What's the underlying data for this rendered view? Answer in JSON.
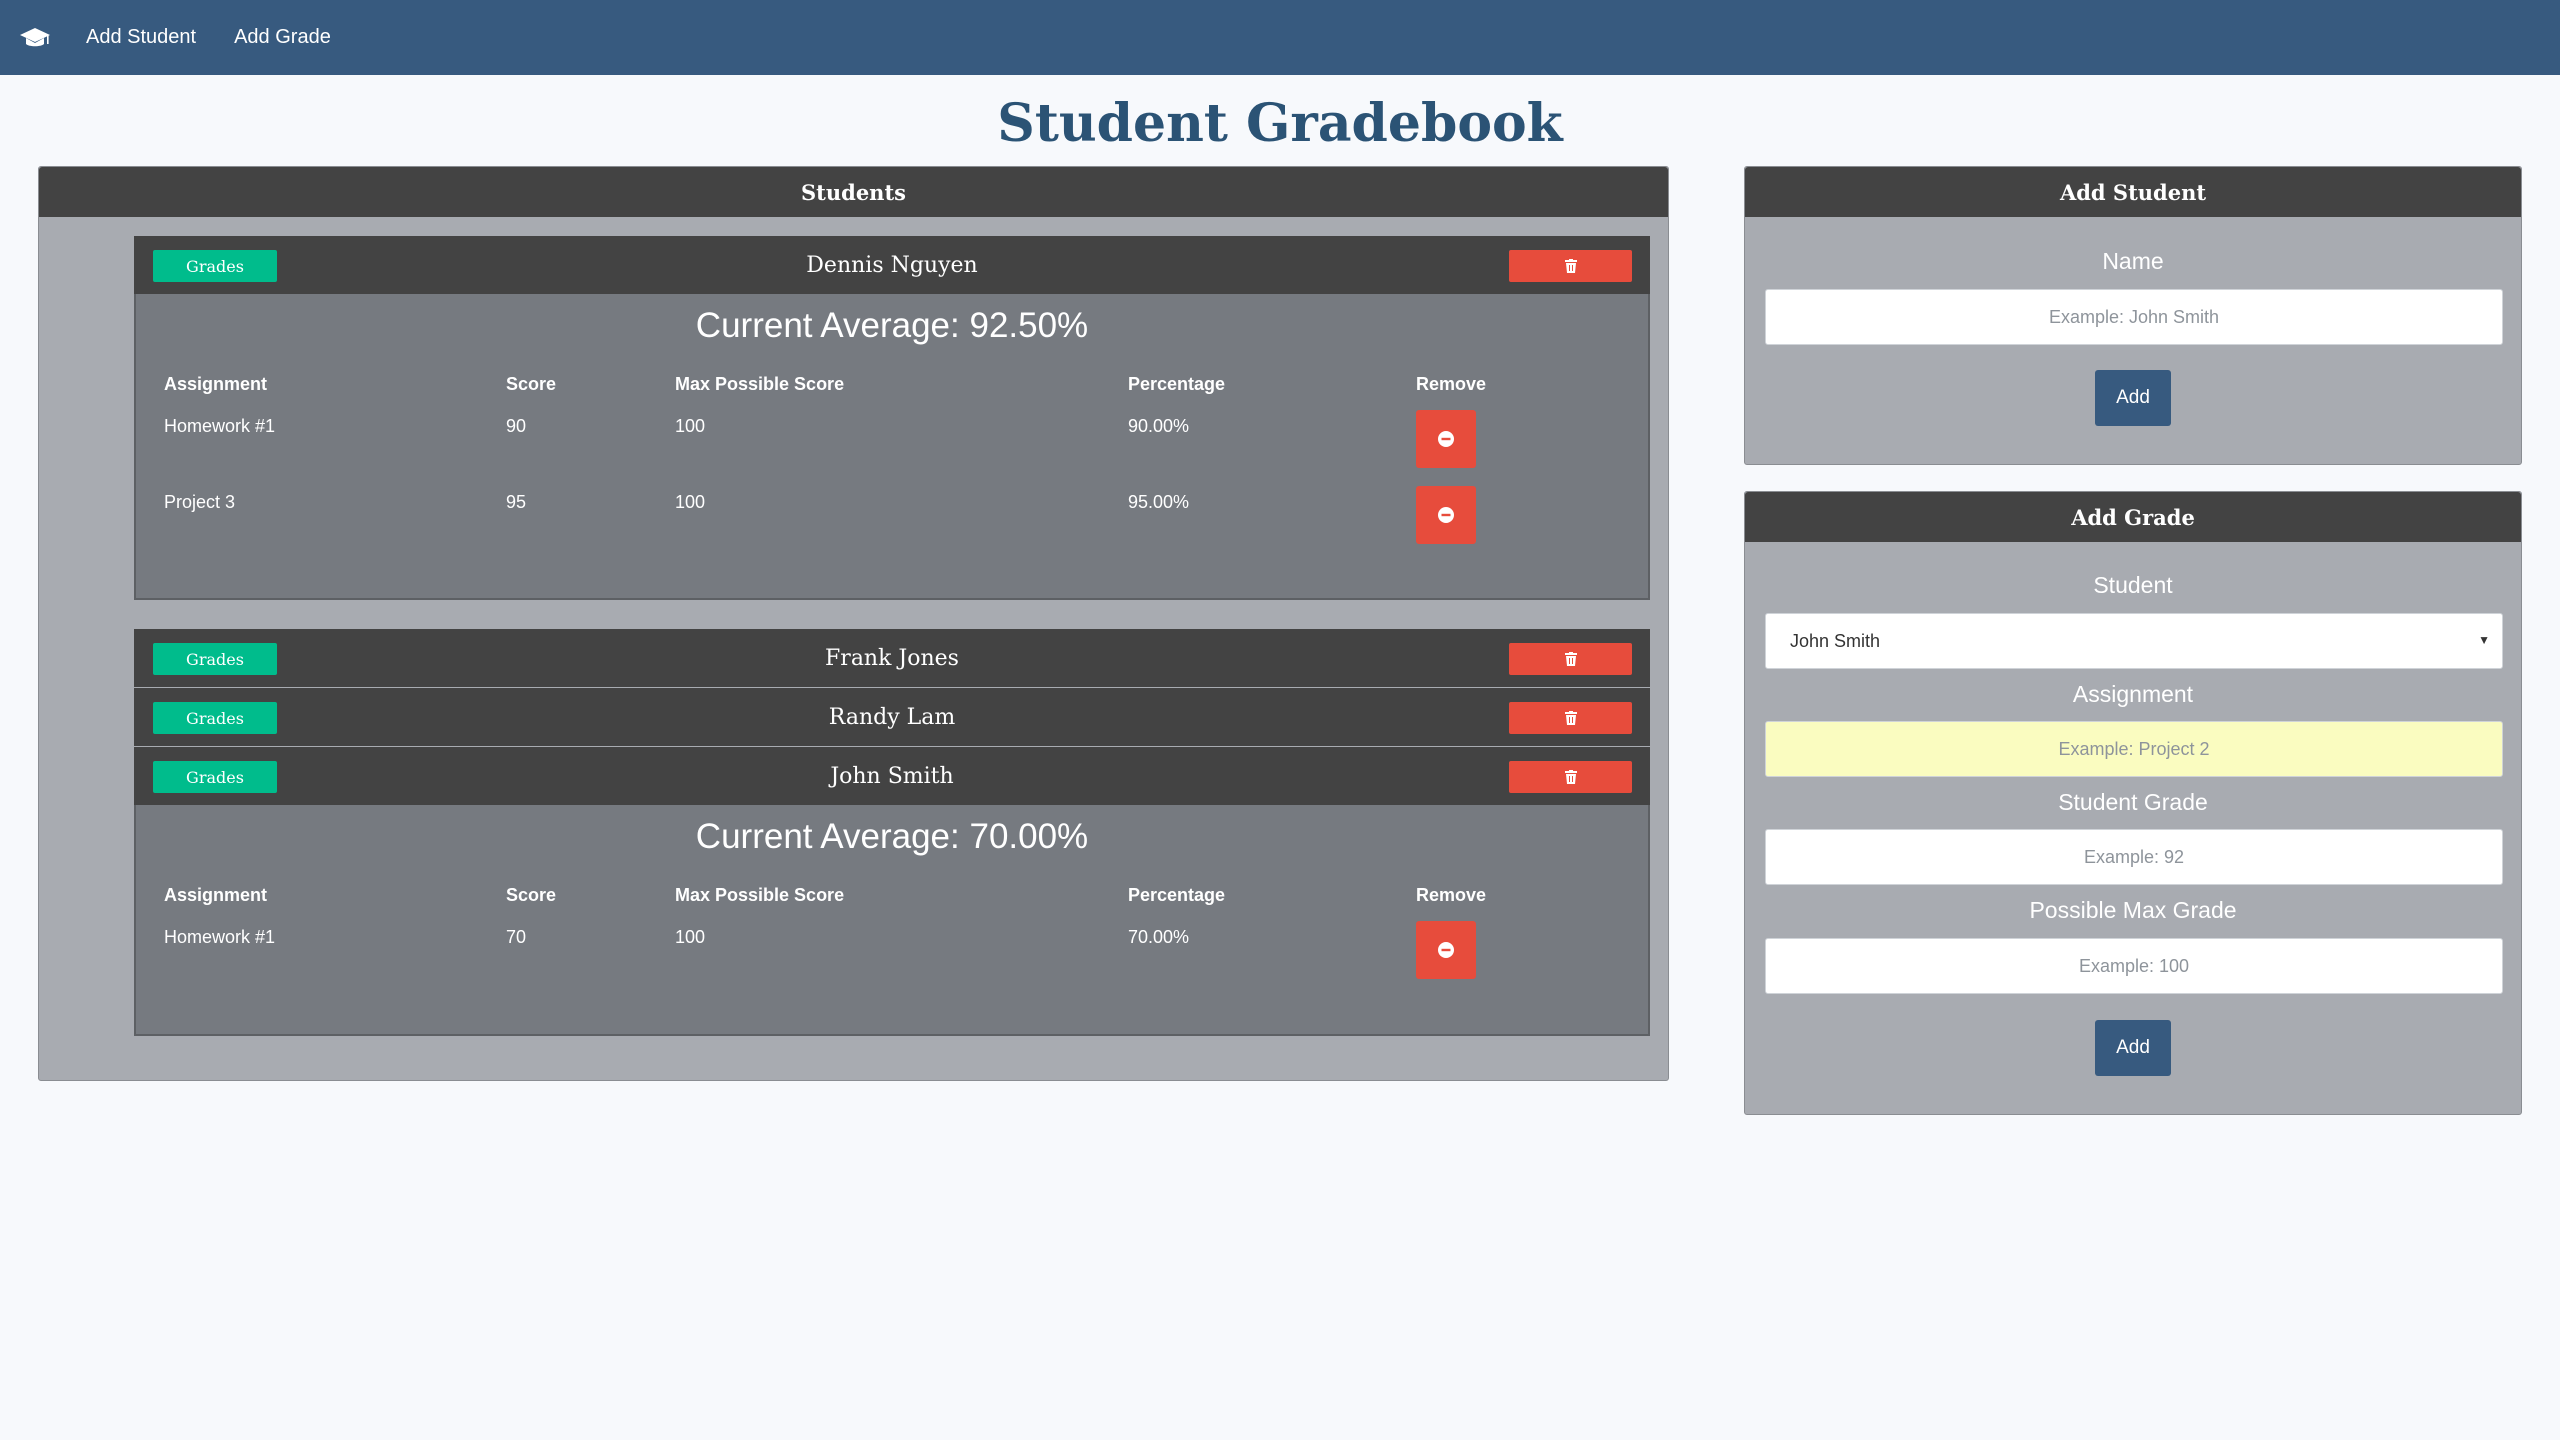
{
  "navbar": {
    "brand_icon": "graduation-cap-icon",
    "links": [
      "Add Student",
      "Add Grade"
    ],
    "color": "#375a7f"
  },
  "page_title": "Student Gradebook",
  "students_panel": {
    "title": "Students",
    "grades_button_label": "Grades",
    "delete_icon": "trash-icon",
    "remove_icon": "minus-circle-icon",
    "table_headers": [
      "Assignment",
      "Score",
      "Max Possible Score",
      "Percentage",
      "Remove"
    ],
    "students": [
      {
        "name": "Dennis Nguyen",
        "expanded": true,
        "average": "Current Average: 92.50%",
        "grades": [
          {
            "assignment": "Homework #1",
            "score": "90",
            "max": "100",
            "percentage": "90.00%"
          },
          {
            "assignment": "Project 3",
            "score": "95",
            "max": "100",
            "percentage": "95.00%"
          }
        ]
      },
      {
        "name": "Frank Jones",
        "expanded": false
      },
      {
        "name": "Randy Lam",
        "expanded": false
      },
      {
        "name": "John Smith",
        "expanded": true,
        "average": "Current Average: 70.00%",
        "grades": [
          {
            "assignment": "Homework #1",
            "score": "70",
            "max": "100",
            "percentage": "70.00%"
          }
        ]
      }
    ]
  },
  "add_student": {
    "title": "Add Student",
    "name_label": "Name",
    "name_placeholder": "Example: John Smith",
    "add_label": "Add"
  },
  "add_grade": {
    "title": "Add Grade",
    "student_label": "Student",
    "student_selected": "John Smith",
    "assignment_label": "Assignment",
    "assignment_placeholder": "Example: Project 2",
    "student_grade_label": "Student Grade",
    "student_grade_placeholder": "Example: 92",
    "max_grade_label": "Possible Max Grade",
    "max_grade_placeholder": "Example: 100",
    "add_label": "Add"
  },
  "colors": {
    "header_dark": "#434343",
    "panel_bg": "#a8abb1",
    "card_body": "#767a80",
    "success": "#00bc8c",
    "danger": "#e74c3c",
    "primary": "#375a7f",
    "title": "#2b5375"
  }
}
